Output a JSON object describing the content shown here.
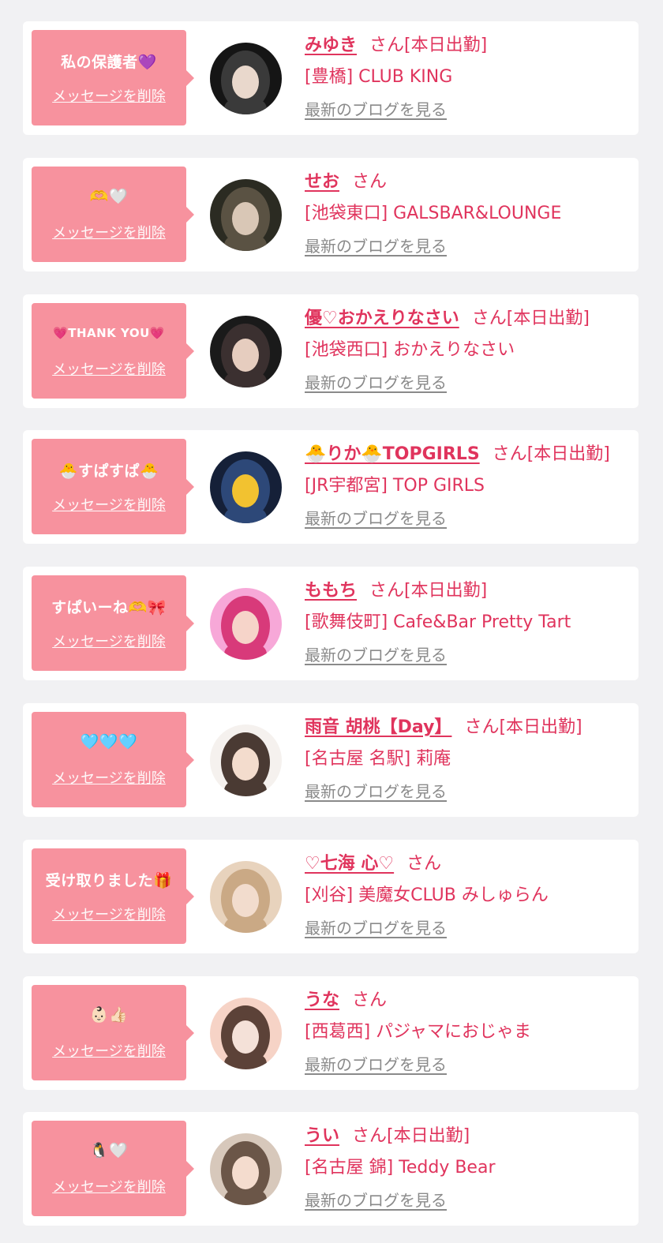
{
  "delete_label": "メッセージを削除",
  "san_label": "さん",
  "blog_label": "最新のブログを見る",
  "cards": [
    {
      "message": "私の保護者💜",
      "name": "みゆき",
      "today": "[本日出勤]",
      "shop": "[豊橋] CLUB KING",
      "avatar_colors": [
        "#151515",
        "#3a3a3a",
        "#e9d8cc"
      ]
    },
    {
      "message": "🫶🤍",
      "name": "せお",
      "today": "",
      "shop": "[池袋東口] GALSBAR&LOUNGE",
      "avatar_colors": [
        "#2b2b22",
        "#5a5243",
        "#d9c7b6"
      ]
    },
    {
      "message": "💗THANK YOU💗",
      "name": "優♡おかえりなさい",
      "today": "[本日出勤]",
      "shop": "[池袋西口] おかえりなさい",
      "avatar_colors": [
        "#1a1a1a",
        "#3b3030",
        "#e6cdbf"
      ]
    },
    {
      "message": "🐣すぱすぱ🐣",
      "name": "🐣りか🐣TOPGIRLS",
      "today": "[本日出勤]",
      "shop": "[JR宇都宮] TOP GIRLS",
      "avatar_colors": [
        "#152038",
        "#2d4878",
        "#f2c230"
      ]
    },
    {
      "message": "すぱいーね🫶🎀",
      "name": "ももち",
      "today": "[本日出勤]",
      "shop": "[歌舞伎町] Cafe&Bar Pretty Tart",
      "avatar_colors": [
        "#f7a8d8",
        "#d83a7a",
        "#f6d4c9"
      ]
    },
    {
      "message": "🩵🩵🩵",
      "name": "雨音 胡桃【Day】",
      "today": "[本日出勤]",
      "shop": "[名古屋 名駅] 莉庵",
      "avatar_colors": [
        "#f5f1ee",
        "#4a3a33",
        "#f3dccd"
      ]
    },
    {
      "message": "受け取りました🎁",
      "name": "♡七海 心♡",
      "today": "",
      "shop": "[刈谷] 美魔女CLUB みしゅらん",
      "avatar_colors": [
        "#e8d3bd",
        "#caa985",
        "#f2dccd"
      ]
    },
    {
      "message": "👶🏻👍🏻",
      "name": "うな",
      "today": "",
      "shop": "[西葛西] パジャマにおじゃま",
      "avatar_colors": [
        "#f6d3c6",
        "#5c4238",
        "#f4e1d8"
      ]
    },
    {
      "message": "🐧🤍",
      "name": "うい",
      "today": "[本日出勤]",
      "shop": "[名古屋 錦] Teddy Bear",
      "avatar_colors": [
        "#d7c8bb",
        "#6b5648",
        "#f4dcce"
      ]
    }
  ]
}
